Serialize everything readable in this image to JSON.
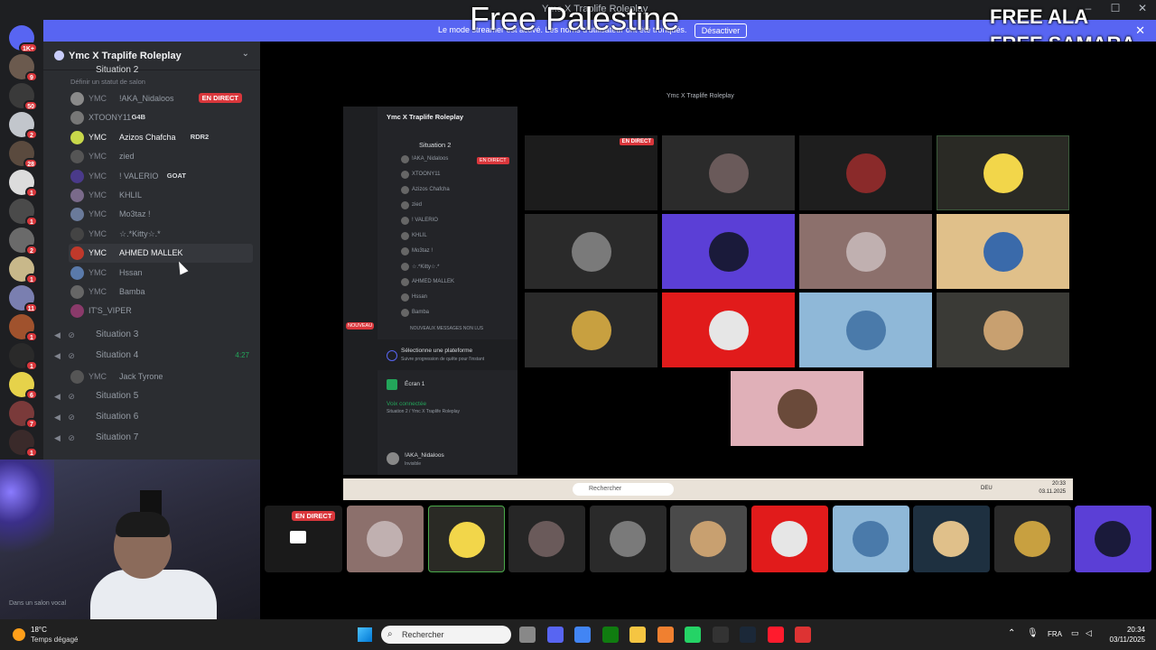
{
  "window": {
    "title": "Ymc X Traplife Roleplay",
    "controls": [
      "–",
      "☐",
      "✕"
    ]
  },
  "streamer_banner": {
    "message": "Le mode streamer est activé. Les noms d'utilisateur ont été tronqués.",
    "button": "Désactiver",
    "close": "✕"
  },
  "overlay": {
    "center": "Free Palestine",
    "right_line1": "FREE ALA",
    "right_line2": "FREE SAMARA"
  },
  "rail": {
    "top_badge": "1K+",
    "servers": [
      {
        "badge": "9",
        "color": "#6b5a4e"
      },
      {
        "badge": "50",
        "color": "#3a3a3a"
      },
      {
        "badge": "2",
        "color": "#c2c6cc"
      },
      {
        "badge": "28",
        "color": "#5a4a3e"
      },
      {
        "badge": "1",
        "color": "#dcdcdc"
      },
      {
        "badge": "1",
        "color": "#4a4a4a"
      },
      {
        "badge": "2",
        "color": "#6a6a6a"
      },
      {
        "badge": "1",
        "color": "#c8b88a"
      },
      {
        "badge": "11",
        "color": "#7a7fb0"
      },
      {
        "badge": "1",
        "color": "#a0522d"
      },
      {
        "badge": "1",
        "color": "#2a2a2a"
      },
      {
        "badge": "6",
        "color": "#e6d24a"
      },
      {
        "badge": "7",
        "color": "#7a3a3a"
      },
      {
        "badge": "1",
        "color": "#3a2a2a"
      }
    ]
  },
  "sidebar": {
    "server_name": "Ymc X Traplife Roleplay",
    "channel_top": "Situation 2",
    "channel_top_status": "Définir un statut de salon",
    "users": [
      {
        "prefix": "YMC",
        "name": "!AKA_Nidaloos",
        "badge": "EN DIRECT",
        "color": "#8a8a8a"
      },
      {
        "prefix": "",
        "name": "XTOONY11",
        "tag": "G4B",
        "color": "#777"
      },
      {
        "prefix": "YMC",
        "name": "Azizos Chafcha",
        "tag": "RDR2",
        "color": "#c8d84a",
        "bright": true
      },
      {
        "prefix": "YMC",
        "name": "zied",
        "color": "#555"
      },
      {
        "prefix": "YMC",
        "name": "! VALERIO",
        "tag": "GOAT",
        "color": "#4a3a8a"
      },
      {
        "prefix": "YMC",
        "name": "KHLIL",
        "color": "#7a6a8a"
      },
      {
        "prefix": "YMC",
        "name": "Mo3taz !",
        "color": "#6a7a9a"
      },
      {
        "prefix": "YMC",
        "name": "☆.*Kitty☆.*",
        "color": "#444"
      },
      {
        "prefix": "YMC",
        "name": "AHMED MALLEK",
        "color": "#c0392b",
        "bright": true
      },
      {
        "prefix": "YMC",
        "name": "Hssan",
        "color": "#5a7aaa"
      },
      {
        "prefix": "YMC",
        "name": "Bamba",
        "color": "#666"
      },
      {
        "prefix": "",
        "name": "IT'S_VIPER",
        "color": "#8a3a6a"
      }
    ],
    "channels": [
      {
        "name": "Situation 3"
      },
      {
        "name": "Situation 4",
        "time": "4:27",
        "users": [
          {
            "prefix": "YMC",
            "name": "Jack Tyrone"
          }
        ]
      },
      {
        "name": "Situation 5"
      },
      {
        "name": "Situation 6"
      },
      {
        "name": "Situation 7"
      }
    ]
  },
  "webcam": {
    "status": "Dans un salon vocal"
  },
  "inner_app": {
    "title": "Ymc X Traplife Roleplay",
    "server_name": "Ymc X Traplife Roleplay",
    "channel": "Situation 2",
    "live_badge": "EN DIRECT",
    "users": [
      "!AKA_Nidaloos",
      "XTOONY11",
      "Azizos Chafcha",
      "zied",
      "! VALERIO",
      "KHLIL",
      "Mo3taz !",
      "☆.*Kitty☆.*",
      "AHMED MALLEK",
      "Hssan",
      "Bamba"
    ],
    "new_messages": "NOUVEAUX MESSAGES NON LUS",
    "platform_title": "Sélectionne une plateforme",
    "platform_sub": "Suivre progression de quête pour l'instant",
    "screen": "Écran 1",
    "voice_connected": "Voix connectée",
    "voice_channel": "Situation 2 / Ymc X Traplife Roleplay",
    "username": "!AKA_Nidaloos",
    "user_status": "Invisible",
    "rail_badge": "NOUVEAU",
    "taskbar_search": "Rechercher",
    "taskbar_lang": "DEU",
    "taskbar_time": "20:33",
    "taskbar_date": "03.11.2025"
  },
  "tiles": [
    {
      "bg": "#2b2b2b",
      "av": "#6a5a5a"
    },
    {
      "bg": "#1e1e1e",
      "av": "#8a2a2a"
    },
    {
      "bg": "#2a2a25",
      "av": "#f2d64a",
      "border": "#3a5a3a"
    },
    {
      "bg": "#2a2a2a",
      "av": "#7a7a7a"
    },
    {
      "bg": "#5b3fd6",
      "av": "#1a1a3a"
    },
    {
      "bg": "#8c706c",
      "av": "#c0b0b0"
    },
    {
      "bg": "#e0c08a",
      "av": "#3a6aaa"
    },
    {
      "bg": "#2a2a2a",
      "av": "#c8a040"
    },
    {
      "bg": "#e11b1b",
      "av": "#e6e6e6"
    },
    {
      "bg": "#8fb8d8",
      "av": "#4a7aaa"
    },
    {
      "bg": "#3a3a36",
      "av": "#c8a070"
    },
    {
      "bg": "#e0b0b8",
      "av": "#6a4a3a"
    }
  ],
  "strip": {
    "live_badge": "EN DIRECT",
    "tiles": [
      {
        "bg": "#8c706c",
        "av": "#c0b0b0"
      },
      {
        "bg": "#2a2a25",
        "av": "#f2d64a",
        "border": "#4aaa4a"
      },
      {
        "bg": "#262626",
        "av": "#6a5a5a"
      },
      {
        "bg": "#2a2a2a",
        "av": "#7a7a7a"
      },
      {
        "bg": "#4a4a4a",
        "av": "#c8a070"
      },
      {
        "bg": "#e11b1b",
        "av": "#e6e6e6"
      },
      {
        "bg": "#8fb8d8",
        "av": "#4a7aaa"
      },
      {
        "bg": "#1e3040",
        "av": "#e0c08a"
      },
      {
        "bg": "#2a2a2a",
        "av": "#c8a040"
      },
      {
        "bg": "#5b3fd6",
        "av": "#1a1a3a"
      }
    ]
  },
  "taskbar": {
    "weather_temp": "18°C",
    "weather_desc": "Temps dégagé",
    "search": "Rechercher",
    "lang": "FRA",
    "time": "20:34",
    "date": "03/11/2025"
  }
}
